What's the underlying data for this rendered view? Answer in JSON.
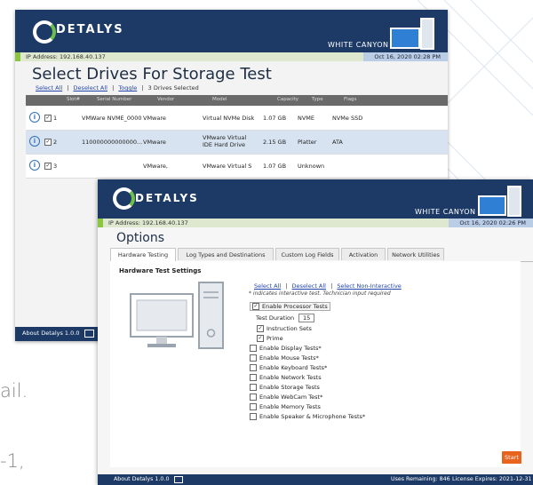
{
  "background_text": {
    "line1": "ail.",
    "line2": "-1,"
  },
  "back_window": {
    "brand": "DETALYS",
    "white_canyon": "WHITE CANYON",
    "ip_address": "IP Address: 192.168.40.137",
    "datetime": "Oct 16, 2020 02:28 PM",
    "title": "Select Drives For Storage Test",
    "select_all": "Select All",
    "deselect_all": "Deselect All",
    "toggle": "Toggle",
    "drives_selected": "3 Drives Selected",
    "separator": "|",
    "columns": [
      "Slot#",
      "Serial Number",
      "Vendor",
      "Model",
      "Capacity",
      "Type",
      "Flags"
    ],
    "rows": [
      {
        "slot": "1",
        "serial": "VMWare NVME_0000",
        "vendor": "VMware",
        "model": "Virtual NVMe Disk",
        "capacity": "1.07 GB",
        "type": "NVME",
        "flags": "NVMe SSD"
      },
      {
        "slot": "2",
        "serial": "110000000000000...",
        "vendor": "VMware",
        "model": "VMware Virtual IDE Hard Drive",
        "capacity": "2.15 GB",
        "type": "Platter",
        "flags": "ATA"
      },
      {
        "slot": "3",
        "serial": "",
        "vendor": "VMware,",
        "model": "VMware Virtual S",
        "capacity": "1.07 GB",
        "type": "Unknown",
        "flags": ""
      }
    ],
    "footer_about": "About Detalys 1.0.0"
  },
  "front_window": {
    "brand": "DETALYS",
    "white_canyon": "WHITE CANYON",
    "ip_address": "IP Address: 192.168.40.137",
    "datetime": "Oct 16, 2020 02:26 PM",
    "title": "Options",
    "tabs": [
      "Hardware Testing",
      "Log Types and Destinations",
      "Custom Log Fields",
      "Activation",
      "Network Utilities"
    ],
    "section_title": "Hardware Test Settings",
    "select_all": "Select All",
    "deselect_all": "Deselect All",
    "select_non_interactive": "Select Non-Interactive",
    "separator": "|",
    "note": "* indicates interactive test. Technician input required",
    "enable_processor": "Enable Processor Tests",
    "test_duration_label": "Test Duration",
    "test_duration_value": "15",
    "instruction_sets": "Instruction Sets",
    "prime": "Prime",
    "options": [
      "Enable Display Tests*",
      "Enable Mouse Tests*",
      "Enable Keyboard Tests*",
      "Enable Network Tests",
      "Enable Storage Tests",
      "Enable WebCam Test*",
      "Enable Memory Tests",
      "Enable Speaker & Microphone Tests*"
    ],
    "start": "Start",
    "footer_about": "About Detalys 1.0.0",
    "footer_uses": "Uses Remaining: 846",
    "footer_license": "License Expires: 2021-12-31"
  }
}
